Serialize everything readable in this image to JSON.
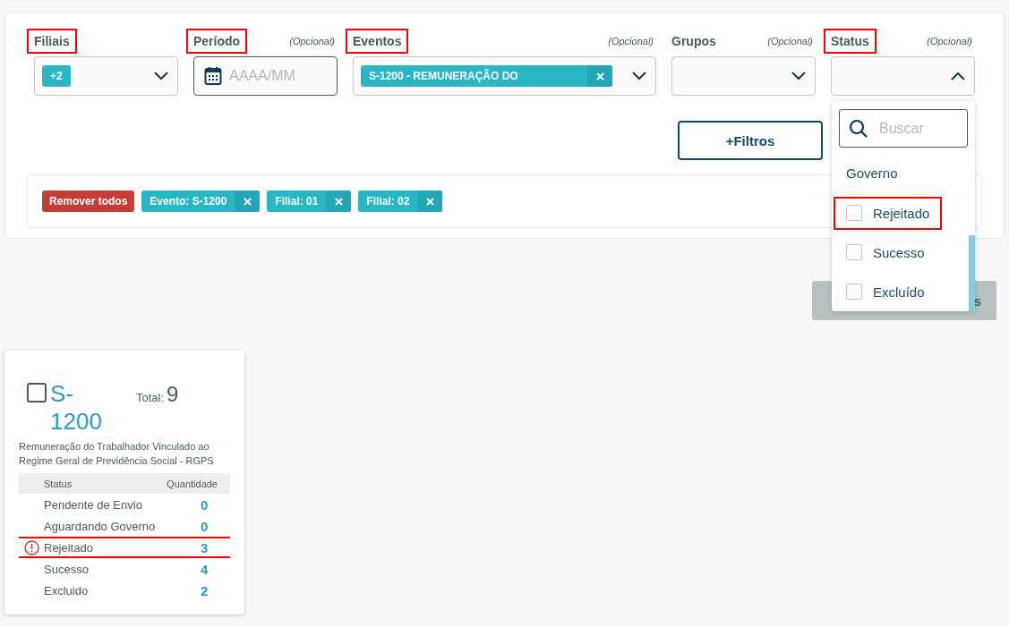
{
  "filters": [
    {
      "label": "Filiais",
      "highlighted": true,
      "kind": "select",
      "chips": [
        {
          "text": "+2",
          "removable": false
        }
      ],
      "expanded": false
    },
    {
      "label": "Período",
      "highlighted": true,
      "hint": "(Opcional)",
      "kind": "date",
      "placeholder": "AAAA/MM"
    },
    {
      "label": "Eventos",
      "highlighted": true,
      "hint": "(Opcional)",
      "kind": "select",
      "chips": [
        {
          "text": "S-1200 - REMUNERAÇÃO DO",
          "removable": true
        }
      ],
      "expanded": false
    },
    {
      "label": "Grupos",
      "highlighted": false,
      "hint": "(Opcional)",
      "kind": "select",
      "expanded": false
    },
    {
      "label": "Status",
      "highlighted": true,
      "hint": "(Opcional)",
      "kind": "select",
      "expanded": true
    }
  ],
  "more_filters_button": "+Filtros",
  "active_filters": {
    "remove_all": "Remover todos",
    "chips": [
      "Evento: S-1200",
      "Filial: 01",
      "Filial: 02"
    ]
  },
  "status_dropdown": {
    "search_placeholder": "Buscar",
    "options": [
      {
        "kind": "continuation",
        "label": "Governo"
      },
      {
        "kind": "checkbox",
        "label": "Rejeitado",
        "checked": false,
        "highlighted": true
      },
      {
        "kind": "checkbox",
        "label": "Sucesso",
        "checked": false,
        "highlighted": false
      },
      {
        "kind": "checkbox",
        "label": "Excluído",
        "checked": false,
        "highlighted": false
      }
    ]
  },
  "background_button": {
    "label": "s"
  },
  "card": {
    "checked": false,
    "code": "S-1200",
    "total_label": "Total:",
    "total": "9",
    "description": "Remuneração do Trabalhador Vinculado ao Regime Geral de Previdência Social - RGPS",
    "columns": [
      "Status",
      "Quantidade"
    ],
    "rows": [
      {
        "status": "Pendente de Envio",
        "count": "0",
        "alert": false,
        "highlighted": false
      },
      {
        "status": "Aguardando Governo",
        "count": "0",
        "alert": false,
        "highlighted": false
      },
      {
        "status": "Rejeitado",
        "count": "3",
        "alert": true,
        "highlighted": true
      },
      {
        "status": "Sucesso",
        "count": "4",
        "alert": false,
        "highlighted": false
      },
      {
        "status": "Excluido",
        "count": "2",
        "alert": false,
        "highlighted": false
      }
    ]
  }
}
